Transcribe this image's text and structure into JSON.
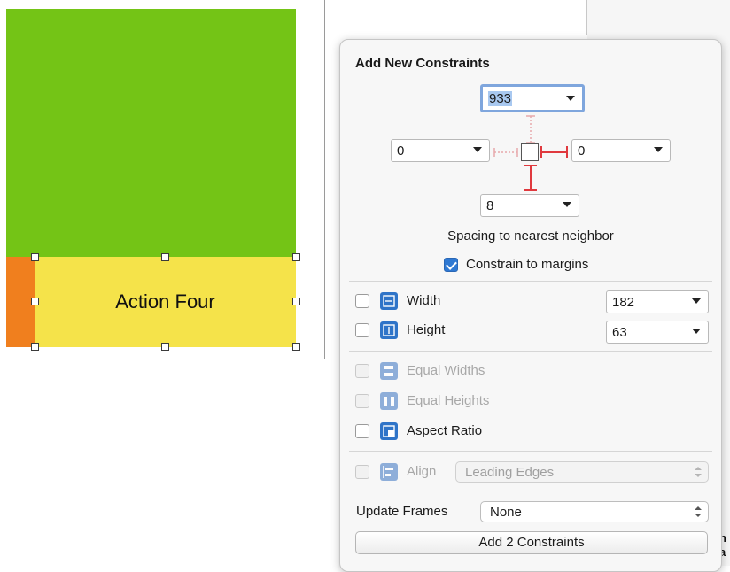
{
  "canvas": {
    "view_label": "Action Four"
  },
  "background_panel": {
    "partial_text": "n\na"
  },
  "popover": {
    "title": "Add New Constraints",
    "top_spacing": "933",
    "left_spacing": "0",
    "right_spacing": "0",
    "bottom_spacing": "8",
    "spacing_caption": "Spacing to nearest neighbor",
    "constrain_to_margins": {
      "label": "Constrain to margins",
      "checked": true
    },
    "width": {
      "label": "Width",
      "value": "182",
      "checked": false
    },
    "height": {
      "label": "Height",
      "value": "63",
      "checked": false
    },
    "equal_widths": {
      "label": "Equal Widths",
      "enabled": false
    },
    "equal_heights": {
      "label": "Equal Heights",
      "enabled": false
    },
    "aspect_ratio": {
      "label": "Aspect Ratio",
      "checked": false
    },
    "align": {
      "label": "Align",
      "selected": "Leading Edges",
      "enabled": false
    },
    "update_frames": {
      "label": "Update Frames",
      "selected": "None"
    },
    "add_button_label": "Add 2 Constraints"
  },
  "colors": {
    "green_view": "#74c416",
    "orange_view": "#f07f1e",
    "yellow_view": "#f5e34a",
    "accent_blue": "#2f74c8",
    "strut_red": "#e0393e"
  }
}
